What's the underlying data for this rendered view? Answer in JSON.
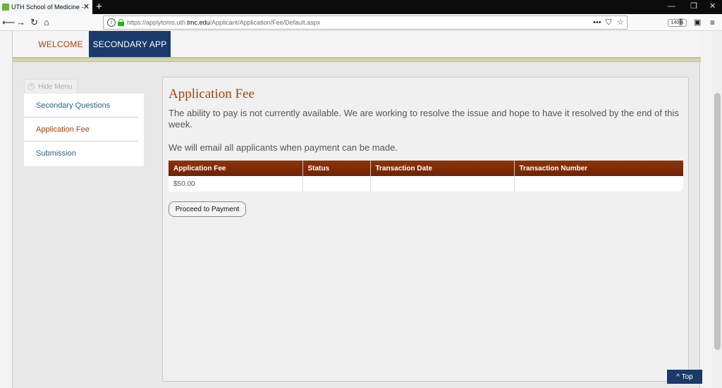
{
  "browser": {
    "tab_title": "UTH School of Medicine - Appl",
    "tab_close": "✕",
    "new_tab": "+",
    "url_prefix": "https://applytoms.uth.",
    "url_domain": "tmc.edu",
    "url_path": "/Applicant/Application/Fee/Default.aspx",
    "zoom": "140%",
    "icons": [
      "back-icon",
      "forward-icon",
      "reload-icon",
      "home-icon",
      "info-icon",
      "lock-icon",
      "more-icon",
      "pocket-icon",
      "bookmark-star-icon",
      "library-icon",
      "sidebar-icon",
      "menu-icon"
    ]
  },
  "topnav": {
    "welcome": "WELCOME",
    "secondary": "SECONDARY APP"
  },
  "sidebar": {
    "hide_menu": "Hide Menu",
    "items": [
      {
        "label": "Secondary Questions"
      },
      {
        "label": "Application Fee"
      },
      {
        "label": "Submission"
      }
    ]
  },
  "main": {
    "title": "Application Fee",
    "paragraph1": "The ability to pay is not currently available. We are working to resolve the issue and hope to have it resolved by the end of this week.",
    "paragraph2": "We will email all applicants when payment can be made.",
    "table": {
      "headers": [
        "Application Fee",
        "Status",
        "Transaction Date",
        "Transaction Number"
      ],
      "rows": [
        [
          "$50.00",
          "",
          "",
          ""
        ]
      ]
    },
    "pay_button": "Proceed to Payment"
  },
  "top_button": "^ Top",
  "colors": {
    "accent": "#a5410d",
    "navy": "#1a3a6b",
    "table_header": "#7a2a06",
    "link": "#2d6487"
  }
}
